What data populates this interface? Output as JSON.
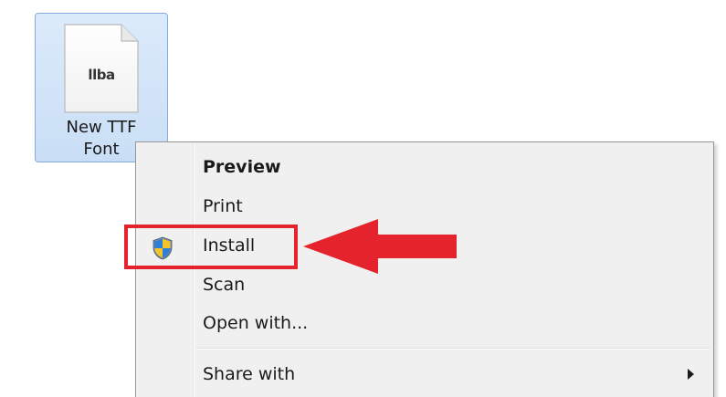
{
  "desktop": {
    "file": {
      "icon": "font-file-icon",
      "glyph": "llba",
      "name_line1": "New TTF",
      "name_line2": "Font",
      "selected": true
    }
  },
  "context_menu": {
    "items": [
      {
        "label": "Preview",
        "bold": true,
        "icon": null
      },
      {
        "label": "Print",
        "bold": false,
        "icon": null
      },
      {
        "label": "Install",
        "bold": false,
        "icon": "uac-shield-icon"
      },
      {
        "label": "Scan",
        "bold": false,
        "icon": null
      },
      {
        "label": "Open with...",
        "bold": false,
        "icon": null
      },
      {
        "label": "Share with",
        "bold": false,
        "icon": null,
        "submenu": true
      }
    ]
  },
  "annotation": {
    "highlight_color": "#e5232d",
    "arrow_color": "#e5232d",
    "target": "Install"
  },
  "colors": {
    "selection_fill": "#cde1f7",
    "selection_border": "#84acdd",
    "menu_background": "#f0f0f0",
    "menu_border": "#979797"
  }
}
